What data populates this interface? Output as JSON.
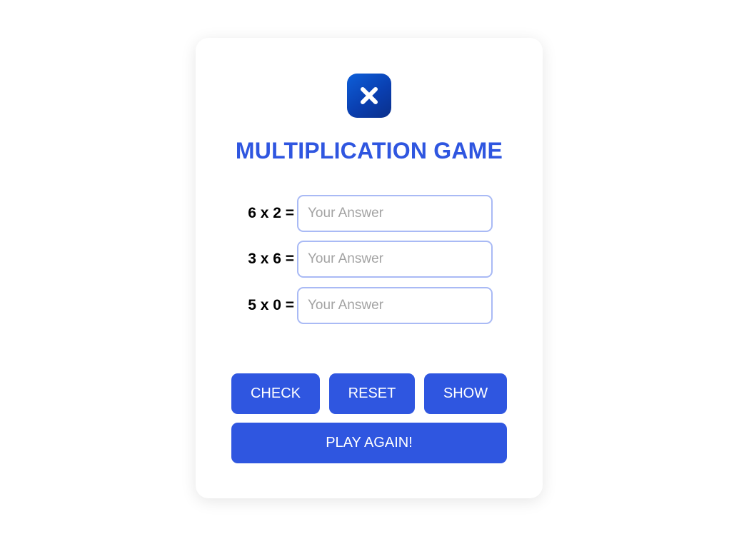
{
  "app": {
    "title": "MULTIPLICATION GAME",
    "logo_icon": "close-icon",
    "accent_color": "#2f56e0"
  },
  "questions": [
    {
      "label": "6 x 2 =",
      "value": "",
      "placeholder": "Your Answer"
    },
    {
      "label": "3 x 6 =",
      "value": "",
      "placeholder": "Your Answer"
    },
    {
      "label": "5 x 0 =",
      "value": "",
      "placeholder": "Your Answer"
    }
  ],
  "buttons": {
    "check": "CHECK",
    "reset": "RESET",
    "show": "SHOW",
    "play_again": "PLAY AGAIN!"
  }
}
